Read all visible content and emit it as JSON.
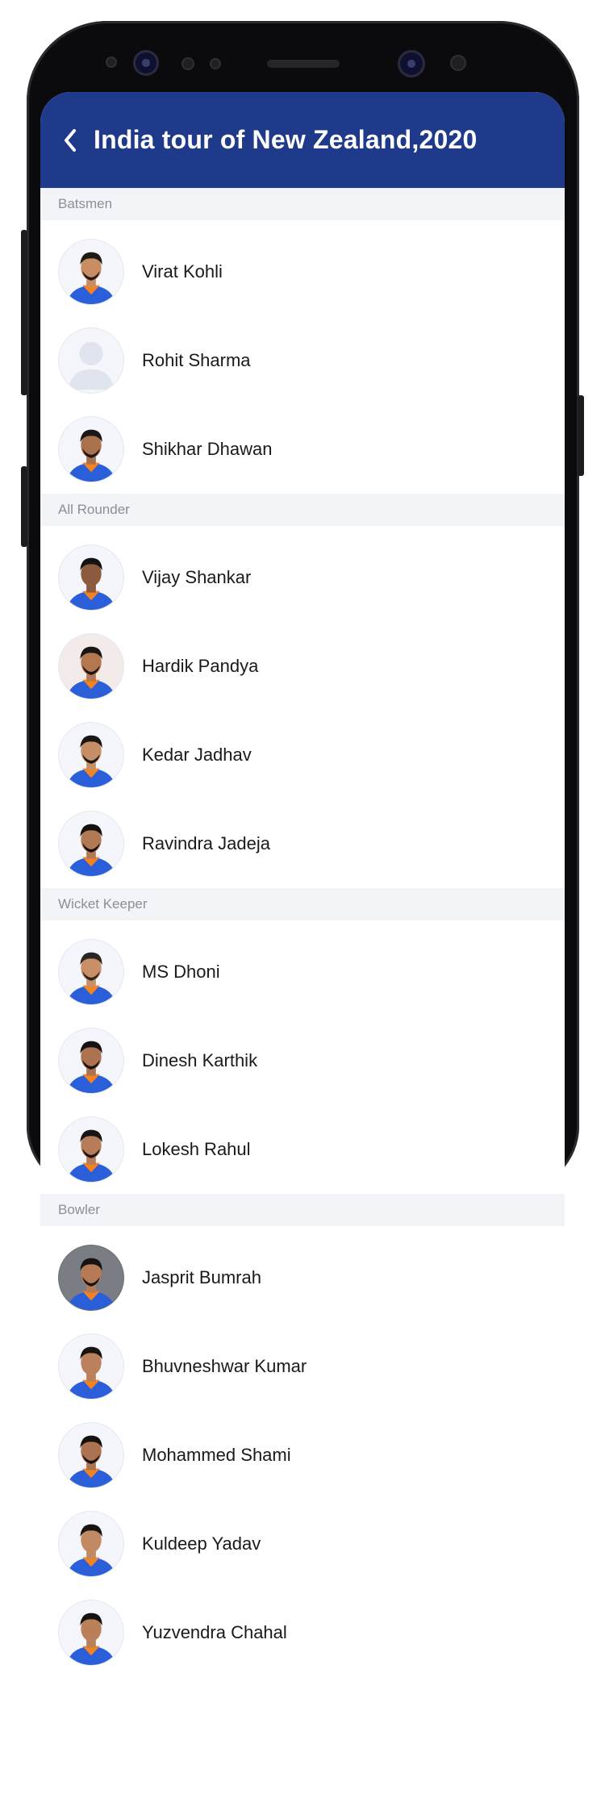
{
  "header": {
    "title": "India tour of New Zealand,2020",
    "back_icon": "chevron-left-icon"
  },
  "colors": {
    "header_background": "#1f3a8a",
    "section_background": "#f2f4f8",
    "section_text": "#8a8f98",
    "jersey_blue": "#2b5fd9"
  },
  "sections": [
    {
      "label": "Batsmen",
      "players": [
        {
          "name": "Virat Kohli"
        },
        {
          "name": "Rohit Sharma"
        },
        {
          "name": "Shikhar Dhawan"
        }
      ]
    },
    {
      "label": "All Rounder",
      "players": [
        {
          "name": "Vijay Shankar"
        },
        {
          "name": "Hardik Pandya"
        },
        {
          "name": "Kedar Jadhav"
        },
        {
          "name": "Ravindra Jadeja"
        }
      ]
    },
    {
      "label": "Wicket Keeper",
      "players": [
        {
          "name": "MS Dhoni"
        },
        {
          "name": "Dinesh Karthik"
        },
        {
          "name": "Lokesh Rahul"
        }
      ]
    },
    {
      "label": "Bowler",
      "players": [
        {
          "name": "Jasprit Bumrah"
        },
        {
          "name": "Bhuvneshwar Kumar"
        },
        {
          "name": "Mohammed Shami"
        },
        {
          "name": "Kuldeep Yadav"
        },
        {
          "name": "Yuzvendra Chahal"
        }
      ]
    }
  ]
}
